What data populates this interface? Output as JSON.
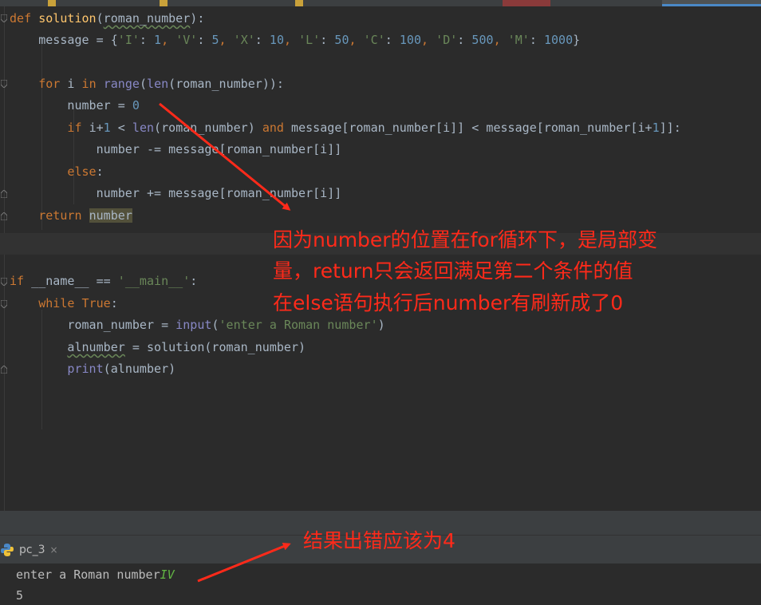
{
  "editor": {
    "lines": {
      "l1": {
        "t1": "def ",
        "t2": "solution",
        "t3": "(",
        "t4": "roman_number",
        "t5": "):"
      },
      "l2": {
        "t1": "    message = {",
        "t2": "'I'",
        "t3": ": ",
        "t4": "1",
        "t5": ", ",
        "t6": "'V'",
        "t7": ": ",
        "t8": "5",
        "t9": ", ",
        "t10": "'X'",
        "t11": ": ",
        "t12": "10",
        "t13": ", ",
        "t14": "'L'",
        "t15": ": ",
        "t16": "50",
        "t17": ", ",
        "t18": "'C'",
        "t19": ": ",
        "t20": "100",
        "t21": ", ",
        "t22": "'D'",
        "t23": ": ",
        "t24": "500",
        "t25": ", ",
        "t26": "'M'",
        "t27": ": ",
        "t28": "1000",
        "t29": "}"
      },
      "l4": {
        "t1": "    ",
        "t2": "for",
        "t3": " i ",
        "t4": "in",
        "t5": " ",
        "t6": "range",
        "t7": "(",
        "t8": "len",
        "t9": "(roman_number)):"
      },
      "l5": {
        "t1": "        number = ",
        "t2": "0"
      },
      "l6": {
        "t1": "        ",
        "t2": "if",
        "t3": " i+",
        "t4": "1",
        "t5": " < ",
        "t6": "len",
        "t7": "(roman_number) ",
        "t8": "and",
        "t9": " message[roman_number[i]] < message[roman_number[i+",
        "t10": "1",
        "t11": "]]:"
      },
      "l7": {
        "t1": "            number -= message[roman_number[i]]"
      },
      "l8": {
        "t1": "        ",
        "t2": "else",
        "t3": ":"
      },
      "l9": {
        "t1": "            number += message[roman_number[i]]"
      },
      "l10": {
        "t1": "    ",
        "t2": "return",
        "t3": " ",
        "t4": "number"
      },
      "l13": {
        "t1": "if",
        "t2": " __name__ == ",
        "t3": "'__main__'",
        "t4": ":"
      },
      "l14": {
        "t1": "    ",
        "t2": "while",
        "t3": " ",
        "t4": "True",
        "t5": ":"
      },
      "l15": {
        "t1": "        roman_number = ",
        "t2": "input",
        "t3": "(",
        "t4": "'enter a Roman number'",
        "t5": ")"
      },
      "l16": {
        "t1": "        ",
        "t2": "alnumber",
        "t3": " = solution(roman_number)"
      },
      "l17": {
        "t1": "        ",
        "t2": "print",
        "t3": "(alnumber)"
      }
    }
  },
  "run_panel": {
    "tab_label": "pc_3",
    "tab_close": "×",
    "console": {
      "prompt": "enter a Roman number",
      "input": "IV",
      "output": "5"
    }
  },
  "annotations": {
    "note1_line1": "因为number的位置在for循环下，是局部变",
    "note1_line2": "量，return只会返回满足第二个条件的值",
    "note1_line3": "在else语句执行后number有刷新成了0",
    "note2": "结果出错应该为4"
  },
  "colors": {
    "annotation": "#ff2a1a",
    "keyword": "#cc7832",
    "function": "#ffc66d",
    "string": "#6a8759",
    "number": "#6897bb"
  }
}
